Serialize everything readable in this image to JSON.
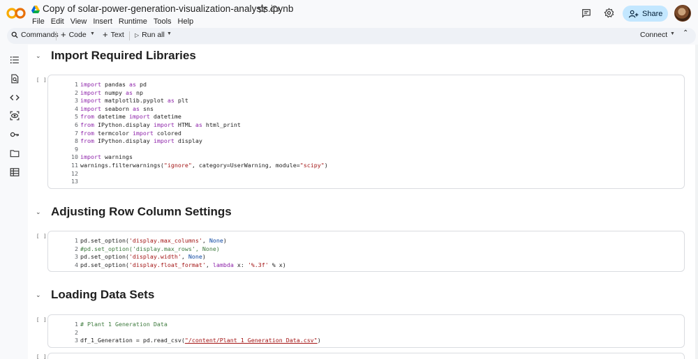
{
  "header": {
    "title": "Copy of solar-power-generation-visualization-analysis.ipynb",
    "menu": [
      "File",
      "Edit",
      "View",
      "Insert",
      "Runtime",
      "Tools",
      "Help"
    ],
    "share_label": "Share"
  },
  "toolbar": {
    "commands": "Commands",
    "code": "Code",
    "text": "Text",
    "run_all": "Run all",
    "connect": "Connect"
  },
  "colors": {
    "accent": "#c3e7ff",
    "keyword": "#8e24aa",
    "string": "#a31515",
    "constant": "#0d47a1",
    "comment": "#3d7a3d"
  },
  "sections": [
    {
      "title": "Import Required Libraries",
      "run_indicator": "[ ]",
      "lines": [
        [
          {
            "t": "import",
            "c": "kw"
          },
          {
            "t": " pandas ",
            "c": "pl"
          },
          {
            "t": "as",
            "c": "kw"
          },
          {
            "t": " pd",
            "c": "pl"
          }
        ],
        [
          {
            "t": "import",
            "c": "kw"
          },
          {
            "t": " numpy ",
            "c": "pl"
          },
          {
            "t": "as",
            "c": "kw"
          },
          {
            "t": " np",
            "c": "pl"
          }
        ],
        [
          {
            "t": "import",
            "c": "kw"
          },
          {
            "t": " matplotlib.pyplot ",
            "c": "pl"
          },
          {
            "t": "as",
            "c": "kw"
          },
          {
            "t": " plt",
            "c": "pl"
          }
        ],
        [
          {
            "t": "import",
            "c": "kw"
          },
          {
            "t": " seaborn ",
            "c": "pl"
          },
          {
            "t": "as",
            "c": "kw"
          },
          {
            "t": " sns",
            "c": "pl"
          }
        ],
        [
          {
            "t": "from",
            "c": "kw"
          },
          {
            "t": " datetime ",
            "c": "pl"
          },
          {
            "t": "import",
            "c": "kw"
          },
          {
            "t": " datetime",
            "c": "pl"
          }
        ],
        [
          {
            "t": "from",
            "c": "kw"
          },
          {
            "t": " IPython.display ",
            "c": "pl"
          },
          {
            "t": "import",
            "c": "kw"
          },
          {
            "t": " HTML ",
            "c": "pl"
          },
          {
            "t": "as",
            "c": "kw"
          },
          {
            "t": " html_print",
            "c": "pl"
          }
        ],
        [
          {
            "t": "from",
            "c": "kw"
          },
          {
            "t": " termcolor ",
            "c": "pl"
          },
          {
            "t": "import",
            "c": "kw"
          },
          {
            "t": " colored",
            "c": "pl"
          }
        ],
        [
          {
            "t": "from",
            "c": "kw"
          },
          {
            "t": " IPython.display ",
            "c": "pl"
          },
          {
            "t": "import",
            "c": "kw"
          },
          {
            "t": " display",
            "c": "pl"
          }
        ],
        [],
        [
          {
            "t": "import",
            "c": "kw"
          },
          {
            "t": " warnings",
            "c": "pl"
          }
        ],
        [
          {
            "t": "warnings.filterwarnings(",
            "c": "pl"
          },
          {
            "t": "\"ignore\"",
            "c": "str"
          },
          {
            "t": ", category=UserWarning, module=",
            "c": "pl"
          },
          {
            "t": "\"scipy\"",
            "c": "str"
          },
          {
            "t": ")",
            "c": "pl"
          }
        ],
        [],
        []
      ]
    },
    {
      "title": "Adjusting Row Column Settings",
      "run_indicator": "[ ]",
      "lines": [
        [
          {
            "t": "pd.set_option(",
            "c": "pl"
          },
          {
            "t": "'display.max_columns'",
            "c": "str"
          },
          {
            "t": ", ",
            "c": "pl"
          },
          {
            "t": "None",
            "c": "kwc"
          },
          {
            "t": ")",
            "c": "pl"
          }
        ],
        [
          {
            "t": "#pd.set_option('display.max_rows', None)",
            "c": "cmt"
          }
        ],
        [
          {
            "t": "pd.set_option(",
            "c": "pl"
          },
          {
            "t": "'display.width'",
            "c": "str"
          },
          {
            "t": ", ",
            "c": "pl"
          },
          {
            "t": "None",
            "c": "kwc"
          },
          {
            "t": ")",
            "c": "pl"
          }
        ],
        [
          {
            "t": "pd.set_option(",
            "c": "pl"
          },
          {
            "t": "'display.float_format'",
            "c": "str"
          },
          {
            "t": ", ",
            "c": "pl"
          },
          {
            "t": "lambda",
            "c": "kw"
          },
          {
            "t": " x: ",
            "c": "pl"
          },
          {
            "t": "'%.3f'",
            "c": "str"
          },
          {
            "t": " % x)",
            "c": "pl"
          }
        ]
      ]
    },
    {
      "title": "Loading Data Sets",
      "run_indicator": "[ ]",
      "lines": [
        [
          {
            "t": "# Plant 1 Generation Data",
            "c": "cmt"
          }
        ],
        [],
        [
          {
            "t": "df_1_Generation = pd.read_csv(",
            "c": "pl"
          },
          {
            "t": "\"/content/Plant_1_Generation_Data.csv\"",
            "c": "lnk"
          },
          {
            "t": ")",
            "c": "pl"
          }
        ]
      ]
    }
  ],
  "extra_run_indicator": "[ ]"
}
